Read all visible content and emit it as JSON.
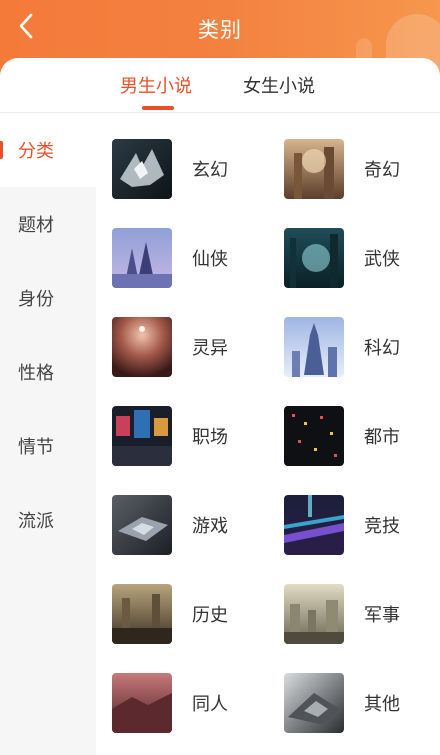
{
  "header": {
    "title": "类别",
    "accent_color": "#f47a3a",
    "back_icon": "chevron-left-icon"
  },
  "tabs": [
    {
      "label": "男生小说",
      "active": true
    },
    {
      "label": "女生小说",
      "active": false
    }
  ],
  "sidebar": {
    "items": [
      {
        "label": "分类",
        "active": true
      },
      {
        "label": "题材",
        "active": false
      },
      {
        "label": "身份",
        "active": false
      },
      {
        "label": "性格",
        "active": false
      },
      {
        "label": "情节",
        "active": false
      },
      {
        "label": "流派",
        "active": false
      }
    ]
  },
  "categories": [
    {
      "label": "玄幻",
      "cover": "xuanhuan-cover"
    },
    {
      "label": "奇幻",
      "cover": "qihuan-cover"
    },
    {
      "label": "仙侠",
      "cover": "xianxia-cover"
    },
    {
      "label": "武侠",
      "cover": "wuxia-cover"
    },
    {
      "label": "灵异",
      "cover": "lingyi-cover"
    },
    {
      "label": "科幻",
      "cover": "kehuan-cover"
    },
    {
      "label": "职场",
      "cover": "zhichang-cover"
    },
    {
      "label": "都市",
      "cover": "dushi-cover"
    },
    {
      "label": "游戏",
      "cover": "youxi-cover"
    },
    {
      "label": "竞技",
      "cover": "jingji-cover"
    },
    {
      "label": "历史",
      "cover": "lishi-cover"
    },
    {
      "label": "军事",
      "cover": "junshi-cover"
    },
    {
      "label": "同人",
      "cover": "tongren-cover"
    },
    {
      "label": "其他",
      "cover": "qita-cover"
    }
  ]
}
